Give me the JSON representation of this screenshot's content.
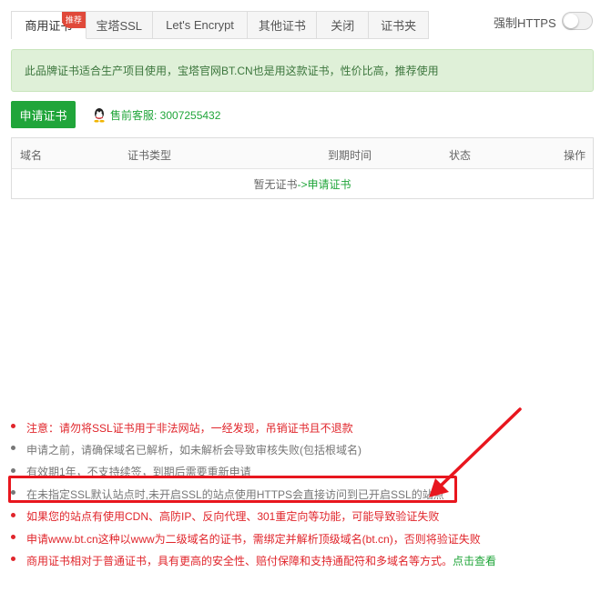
{
  "tabs": [
    {
      "label": "商用证书",
      "badge": "推荐",
      "active": true
    },
    {
      "label": "宝塔SSL"
    },
    {
      "label": "Let's Encrypt"
    },
    {
      "label": "其他证书"
    },
    {
      "label": "关闭"
    },
    {
      "label": "证书夹"
    }
  ],
  "force_https": {
    "label": "强制HTTPS",
    "enabled": false
  },
  "notice": "此品牌证书适合生产项目使用，宝塔官网BT.CN也是用这款证书，性价比高，推荐使用",
  "apply_button": "申请证书",
  "presales": {
    "label": "售前客服: 3007255432"
  },
  "table": {
    "columns": [
      "域名",
      "证书类型",
      "到期时间",
      "状态",
      "操作"
    ],
    "empty_text": "暂无证书 ",
    "empty_link": "->申请证书"
  },
  "tips": [
    {
      "text": "注意：请勿将SSL证书用于非法网站，一经发现，吊销证书且不退款",
      "color": "red"
    },
    {
      "text": "申请之前，请确保域名已解析，如未解析会导致审核失败(包括根域名)",
      "color": "gray"
    },
    {
      "text": "有效期1年，不支持续签，到期后需要重新申请",
      "color": "gray"
    },
    {
      "text": "在未指定SSL默认站点时,未开启SSL的站点使用HTTPS会直接访问到已开启SSL的站点",
      "color": "gray"
    },
    {
      "text": "如果您的站点有使用CDN、高防IP、反向代理、301重定向等功能，可能导致验证失败",
      "color": "red"
    },
    {
      "text": "申请www.bt.cn这种以www为二级域名的证书，需绑定并解析顶级域名(bt.cn)，否则将验证失败",
      "color": "red"
    },
    {
      "text": "商用证书相对于普通证书，具有更高的安全性、赔付保障和支持通配符和多域名等方式。",
      "link": "点击查看",
      "color": "red"
    }
  ],
  "colors": {
    "accent": "#20a53a",
    "warning": "#e0252b",
    "annotation": "#e8161e"
  }
}
